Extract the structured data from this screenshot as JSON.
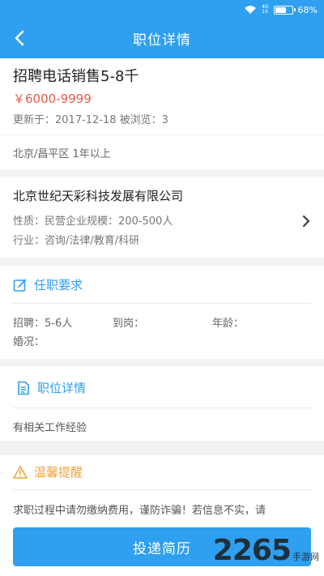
{
  "status_bar": {
    "battery": "68%",
    "battery_level": 0.68,
    "signal_top": "4G",
    "signal_bottom": "1X"
  },
  "nav": {
    "title": "职位详情"
  },
  "job": {
    "title": "招聘电话销售5-8千",
    "salary": "￥6000-9999",
    "updated": "更新于：2017-12-18  被浏览：3",
    "location": "北京/昌平区  1年以上"
  },
  "company": {
    "name": "北京世纪天彩科技发展有限公司",
    "nature": "性质：民营企业规模：200-500人",
    "industry": "行业：咨询/法律/教育/科研"
  },
  "requirements": {
    "header": "任职要求",
    "recruit": "招聘：5-6人",
    "arrival": "到岗：",
    "age": "年龄：",
    "marriage": "婚况："
  },
  "details": {
    "header": "职位详情",
    "text": "有相关工作经验"
  },
  "tips": {
    "header": "温馨提醒",
    "text": "求职过程中请勿缴纳费用，谨防诈骗！若信息不实，请"
  },
  "apply": {
    "label": "投递简历"
  },
  "watermark": {
    "logo": "2265",
    "sub": "手游网"
  },
  "colors": {
    "accent": "#2f9ff0",
    "salary": "#e45b4a",
    "tips": "#f0a33a"
  }
}
